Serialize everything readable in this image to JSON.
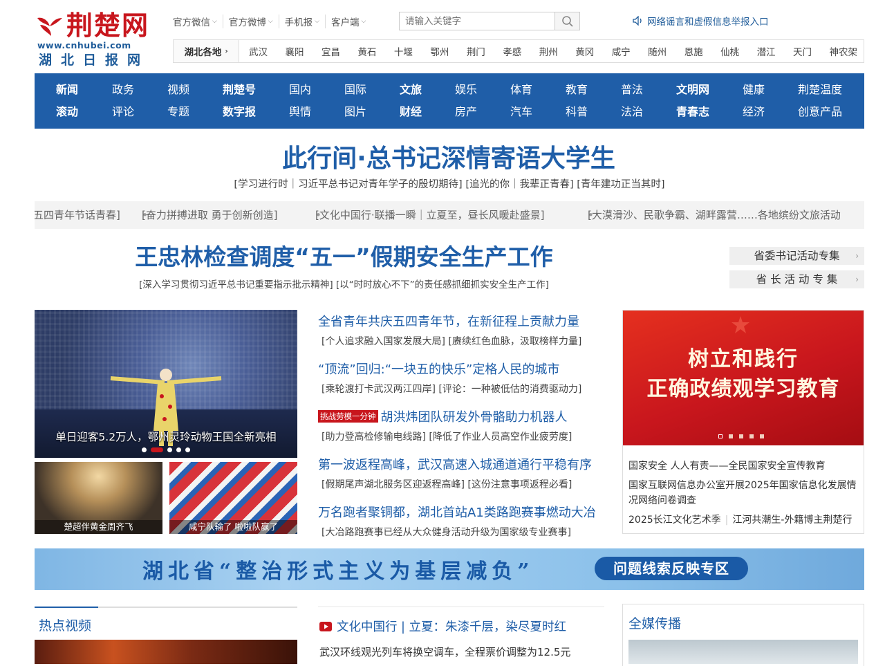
{
  "logo": {
    "brand": "荆楚网",
    "url": "www.cnhubei.com",
    "paper": "湖北日报网"
  },
  "topnav": [
    {
      "label": "官方微信"
    },
    {
      "label": "官方微博"
    },
    {
      "label": "手机报"
    },
    {
      "label": "客户端"
    }
  ],
  "search": {
    "placeholder": "请输入关键字"
  },
  "report": {
    "label": "网络谣言和虚假信息举报入口"
  },
  "regions": {
    "title": "湖北各地",
    "items": [
      "武汉",
      "襄阳",
      "宜昌",
      "黄石",
      "十堰",
      "鄂州",
      "荆门",
      "孝感",
      "荆州",
      "黄冈",
      "咸宁",
      "随州",
      "恩施",
      "仙桃",
      "潜江",
      "天门",
      "神农架"
    ]
  },
  "mainnav": {
    "row1": [
      {
        "label": "新闻",
        "bold": true
      },
      {
        "label": "政务"
      },
      {
        "label": "视频"
      },
      {
        "label": "荆楚号",
        "bold": true
      },
      {
        "label": "国内"
      },
      {
        "label": "国际"
      },
      {
        "label": "文旅",
        "bold": true
      },
      {
        "label": "娱乐"
      },
      {
        "label": "体育"
      },
      {
        "label": "教育"
      },
      {
        "label": "普法"
      },
      {
        "label": "文明网",
        "bold": true
      },
      {
        "label": "健康"
      },
      {
        "label": "荆楚温度"
      }
    ],
    "row2": [
      {
        "label": "滚动",
        "bold": true
      },
      {
        "label": "评论"
      },
      {
        "label": "专题"
      },
      {
        "label": "数字报",
        "bold": true
      },
      {
        "label": "舆情"
      },
      {
        "label": "图片"
      },
      {
        "label": "财经",
        "bold": true
      },
      {
        "label": "房产"
      },
      {
        "label": "汽车"
      },
      {
        "label": "科普"
      },
      {
        "label": "法治"
      },
      {
        "label": "青春志",
        "bold": true
      },
      {
        "label": "经济"
      },
      {
        "label": "创意产品"
      }
    ]
  },
  "headline1": {
    "title": "此行间·总书记深情寄语大学生",
    "sub": "[学习进行时｜习近平总书记对青年学子的殷切期待]  [追光的你｜我辈正青春]  [青年建功正当其时]"
  },
  "ticker": [
    "五四青年节话青春]",
    "[奋力拼搏进取 勇于创新创造]",
    "[文化中国行·联播一瞬｜立夏至，昼长风暖赴盛景]",
    "[大漠滑沙、民歌争霸、湖畔露营……各地缤纷文旅活动"
  ],
  "headline2": {
    "title": "王忠林检查调度“五一”假期安全生产工作",
    "sub": "[深入学习贯彻习近平总书记重要指示批示精神]   [以“时时放心不下”的责任感抓细抓实安全生产工作]"
  },
  "special": [
    {
      "label": "省委书记活动专集"
    },
    {
      "label": "省 长 活 动 专 集"
    }
  ],
  "slider": {
    "caption": "单日迎客5.2万人，鄂州灵玲动物王国全新亮相",
    "active": 1,
    "count": 5
  },
  "thumbs": [
    {
      "caption": "楚超伴黄金周齐飞"
    },
    {
      "caption": "咸宁队输了 啦啦队赢了"
    }
  ],
  "news": [
    {
      "title": "全省青年共庆五四青年节，在新征程上贡献力量",
      "sub": "[个人追求融入国家发展大局]  [赓续红色血脉，汲取榜样力量]"
    },
    {
      "title": "“顶流”回归:“一块五的快乐”定格人民的城市",
      "sub": "[乘轮渡打卡武汉两江四岸]  [评论：一种被低估的消费驱动力]"
    },
    {
      "tag": "挑战劳模一分钟",
      "title": "胡洪炜团队研发外骨骼助力机器人",
      "sub": "[助力登高检修输电线路]  [降低了作业人员高空作业疲劳度]"
    },
    {
      "title": "第一波返程高峰，武汉高速入城通道通行平稳有序",
      "sub": "[假期尾声湖北服务区迎返程高峰]  [这份注意事项返程必看]"
    },
    {
      "title": "万名跑者聚铜都，湖北首站A1类路跑赛事燃动大冶",
      "sub": "[大冶路跑赛事已经从大众健身活动升级为国家级专业赛事]"
    }
  ],
  "rbox": {
    "line1": "树立和践行",
    "line2": "正确政绩观学习教育",
    "links": [
      "国家安全 人人有责——全民国家安全宣传教育",
      "国家互联网信息办公室开展2025年国家信息化发展情况网络问卷调查",
      "2025长江文化艺术季",
      "江河共潮生-外籍博主荆楚行"
    ]
  },
  "banner": {
    "text": "湖北省“整治形式主义为基层减负”",
    "pill": "问题线索反映专区"
  },
  "sections": {
    "hot_video": "热点视频",
    "media": "全媒传播"
  },
  "mid": {
    "video_title": "文化中国行 | 立夏：朱漆千层，染尽夏时红",
    "line": "武汉环线观光列车将换空调车，全程票价调整为12.5元"
  },
  "colors": {
    "brand_red": "#c8161d",
    "brand_blue": "#1f5ea8"
  }
}
